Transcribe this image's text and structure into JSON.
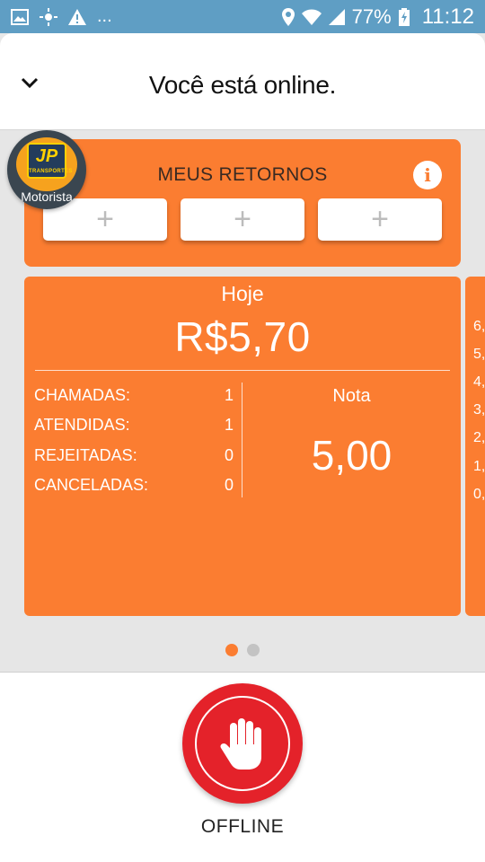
{
  "status_bar": {
    "left_icons": [
      "image-icon",
      "brightness-icon",
      "warning-icon"
    ],
    "ellipsis": "...",
    "battery": "77%",
    "time": "11:12"
  },
  "header": {
    "title": "Você está online."
  },
  "returns": {
    "title": "MEUS RETORNOS",
    "slots": [
      "+",
      "+",
      "+"
    ]
  },
  "avatar": {
    "logo_text": "JP",
    "logo_subtext": "TRANSPORTES",
    "role": "Motorista"
  },
  "today_card": {
    "label": "Hoje",
    "amount": "R$5,70",
    "stats": [
      {
        "label": "CHAMADAS:",
        "value": "1"
      },
      {
        "label": "ATENDIDAS:",
        "value": "1"
      },
      {
        "label": "REJEITADAS:",
        "value": "0"
      },
      {
        "label": "CANCELADAS:",
        "value": "0"
      }
    ],
    "rating_label": "Nota",
    "rating_value": "5,00"
  },
  "next_card": {
    "ticks": [
      "6,",
      "5,",
      "4,",
      "3,",
      "2,",
      "1,",
      "0,"
    ]
  },
  "pager": {
    "active_color": "#fb7d31",
    "inactive_color": "#c3c3c3"
  },
  "offline": {
    "label": "OFFLINE"
  }
}
